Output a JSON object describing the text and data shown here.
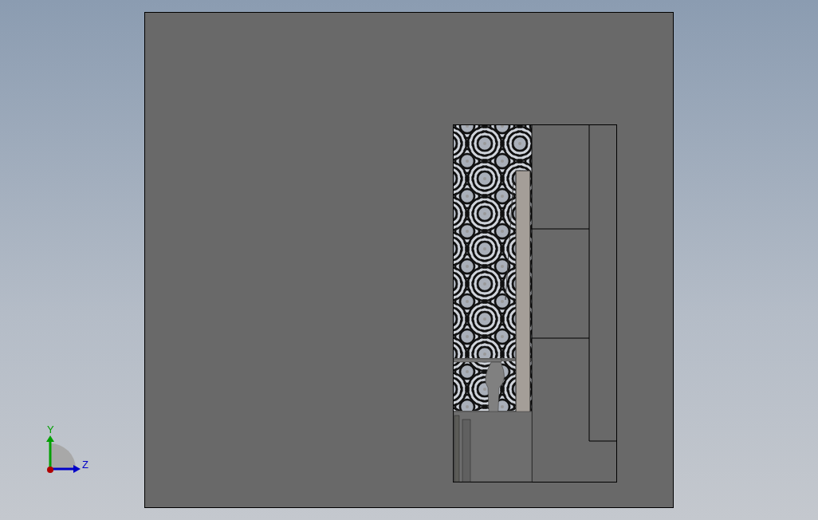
{
  "viewport": {
    "triad_axes": [
      {
        "label": "Y",
        "color": "#00a000"
      },
      {
        "label": "Z",
        "color": "#0000c8"
      }
    ]
  }
}
